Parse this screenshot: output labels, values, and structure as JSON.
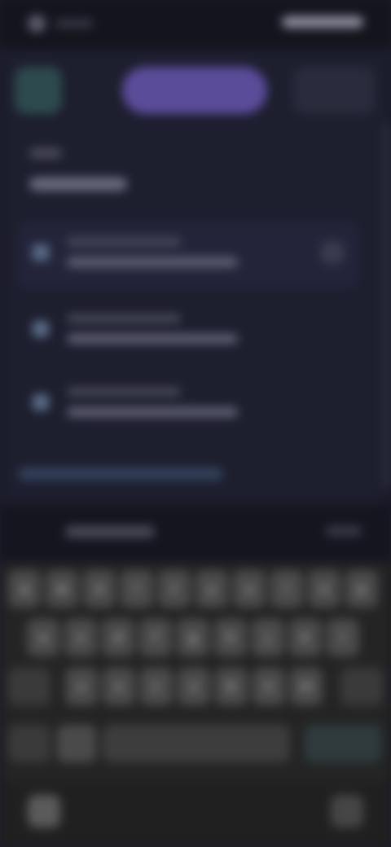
{
  "keyboard": {
    "rows": [
      [
        "q",
        "w",
        "e",
        "r",
        "t",
        "y",
        "u",
        "i",
        "o",
        "p"
      ],
      [
        "a",
        "s",
        "d",
        "f",
        "g",
        "h",
        "j",
        "k",
        "l"
      ],
      [
        "z",
        "x",
        "c",
        "v",
        "b",
        "n",
        "m"
      ]
    ]
  }
}
